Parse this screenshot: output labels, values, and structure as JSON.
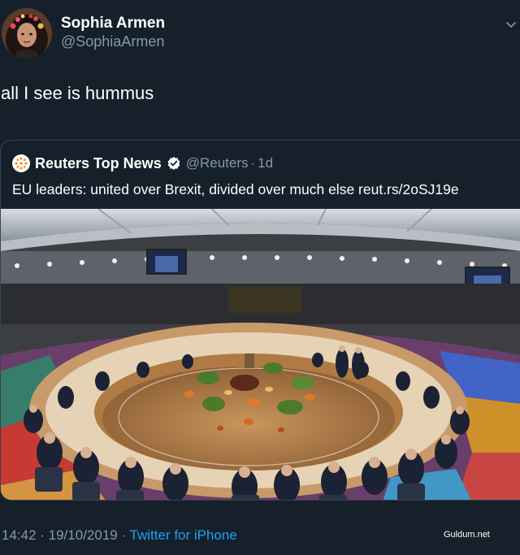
{
  "tweet": {
    "author": {
      "display_name": "Sophia Armen",
      "handle": "@SophiaArmen"
    },
    "text": "all I see is hummus",
    "timestamp": "14:42 · 19/10/2019 ·",
    "source": "Twitter for iPhone"
  },
  "quoted": {
    "display_name": "Reuters Top News",
    "handle": "@Reuters",
    "separator": "·",
    "age": "1d",
    "text": "EU leaders: united over Brexit, divided over much else reut.rs/2oSJ19e"
  },
  "watermark": "Guldum.net",
  "colors": {
    "background": "#15202b",
    "secondary_text": "#8899a6",
    "link": "#1da1f2",
    "border": "#38444d",
    "verified": "#ffffff"
  },
  "icons": [
    "chevron-down-icon",
    "verified-badge-icon",
    "reuters-logo-icon"
  ]
}
